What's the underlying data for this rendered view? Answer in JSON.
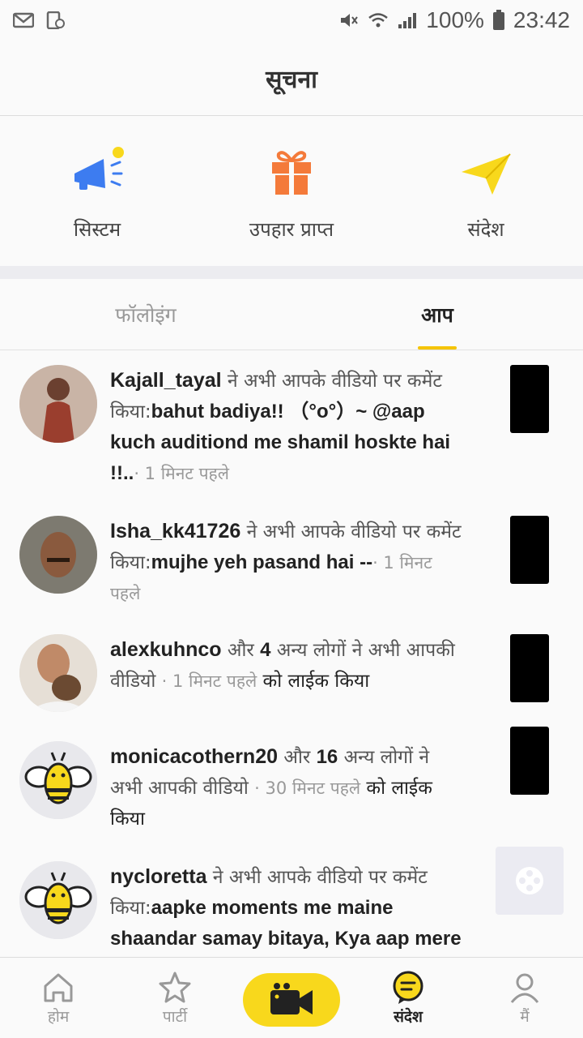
{
  "status_bar": {
    "battery": "100%",
    "time": "23:42"
  },
  "header": {
    "title": "सूचना"
  },
  "shortcuts": [
    {
      "label": "सिस्टम",
      "icon": "megaphone-icon"
    },
    {
      "label": "उपहार प्राप्त",
      "icon": "gift-icon"
    },
    {
      "label": "संदेश",
      "icon": "paper-plane-icon"
    }
  ],
  "tabs": {
    "following": "फॉलोइंग",
    "you": "आप",
    "active": "आप"
  },
  "notifications": [
    {
      "user": "Kajall_tayal",
      "text1": " ने अभी आपके वीडियो पर कमेंट किया:",
      "comment": "bahut badiya!! （°o°）~ @aap kuch auditiond me shamil hoskte hai !!..",
      "time": "· 1 मिनट पहले"
    },
    {
      "user": "Isha_kk41726",
      "text1": " ने अभी आपके वीडियो पर कमेंट किया:",
      "comment": "mujhe yeh pasand hai --",
      "time": "· 1 मिनट पहले"
    },
    {
      "user": "alexkuhnco",
      "text1": " और ",
      "count": "4",
      "text2": " अन्य लोगों ने अभी आपकी वीडियो ",
      "time": "· 1 मिनट पहले",
      "suffix": " को लाईक किया"
    },
    {
      "user": "monicacothern20",
      "text1": " और ",
      "count": "16",
      "text2": " अन्य लोगों ने अभी आपकी वीडियो ",
      "time": "· 30 मिनट पहले",
      "suffix": " को लाईक किया"
    },
    {
      "user": "nycloretta",
      "text1": " ने अभी आपके वीडियो पर कमेंट किया:",
      "comment": "aapke moments me maine shaandar samay bitaya, Kya aap mere"
    }
  ],
  "bottom_nav": [
    {
      "label": "होम",
      "icon": "home-icon"
    },
    {
      "label": "पार्टी",
      "icon": "star-icon"
    },
    {
      "label": "",
      "icon": "video-camera-icon"
    },
    {
      "label": "संदेश",
      "icon": "message-icon"
    },
    {
      "label": "मैं",
      "icon": "profile-icon"
    }
  ],
  "colors": {
    "accent": "#f5c400",
    "record": "#f8d81c",
    "megaphone": "#3d7cf0",
    "gift": "#f47a3a",
    "plane": "#f8d81c"
  }
}
